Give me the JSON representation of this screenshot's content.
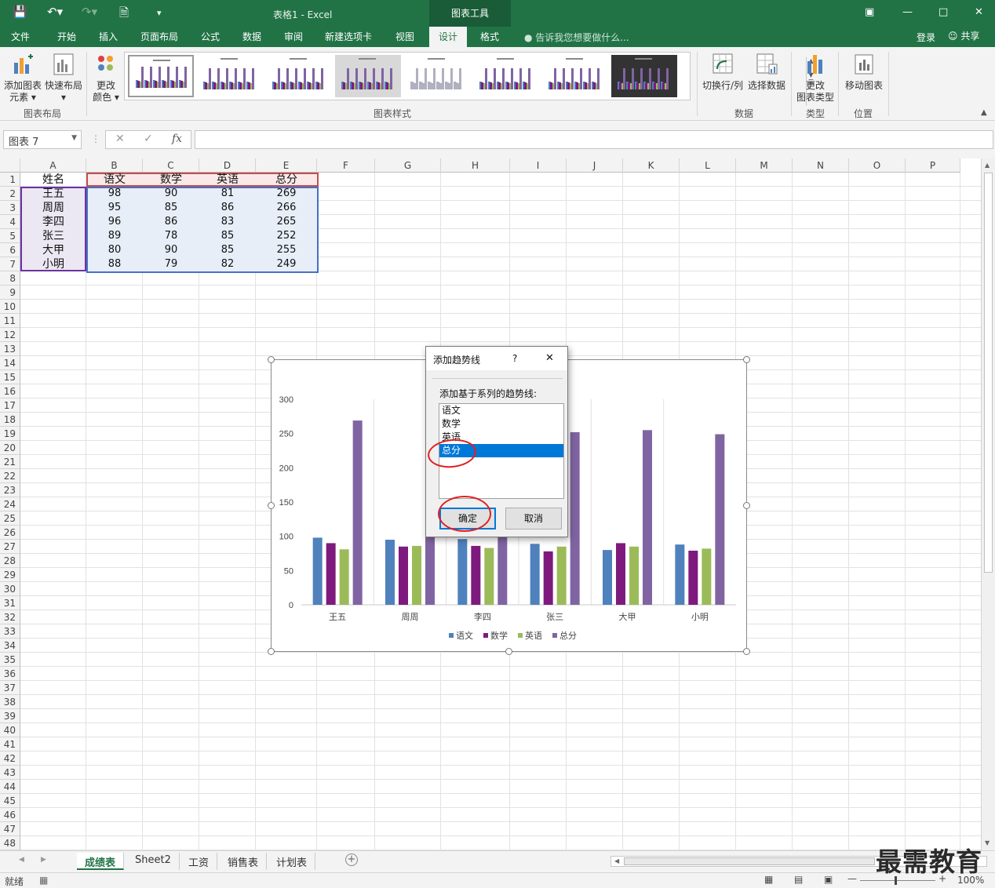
{
  "window": {
    "title": "表格1 - Excel",
    "context_tool": "图表工具",
    "login": "登录",
    "share": "共享"
  },
  "ribbon_tabs": [
    "文件",
    "开始",
    "插入",
    "页面布局",
    "公式",
    "数据",
    "审阅",
    "新建选项卡",
    "视图",
    "设计",
    "格式"
  ],
  "active_tab": "设计",
  "tell_me": "告诉我您想要做什么...",
  "ribbon": {
    "add_element": "添加图表元素",
    "add_element_l1": "添加图表",
    "add_element_l2": "元素",
    "quick_layout": "快速布局",
    "change_color_l1": "更改",
    "change_color_l2": "颜色",
    "group_layout": "图表布局",
    "group_styles": "图表样式",
    "switch_rowcol": "切换行/列",
    "select_data": "选择数据",
    "group_data": "数据",
    "change_type_l1": "更改",
    "change_type_l2": "图表类型",
    "group_type": "类型",
    "move_chart": "移动图表",
    "group_location": "位置"
  },
  "formula_bar": {
    "name_box": "图表 7",
    "fx": "fx",
    "value": ""
  },
  "columns": [
    "A",
    "B",
    "C",
    "D",
    "E",
    "F",
    "G",
    "H",
    "I",
    "J",
    "K",
    "L",
    "M",
    "N",
    "O",
    "P"
  ],
  "table": {
    "headers": [
      "姓名",
      "语文",
      "数学",
      "英语",
      "总分"
    ],
    "rows": [
      [
        "王五",
        "98",
        "90",
        "81",
        "269"
      ],
      [
        "周周",
        "95",
        "85",
        "86",
        "266"
      ],
      [
        "李四",
        "96",
        "86",
        "83",
        "265"
      ],
      [
        "张三",
        "89",
        "78",
        "85",
        "252"
      ],
      [
        "大甲",
        "80",
        "90",
        "85",
        "255"
      ],
      [
        "小明",
        "88",
        "79",
        "82",
        "249"
      ]
    ]
  },
  "chart_data": {
    "type": "bar",
    "categories": [
      "王五",
      "周周",
      "李四",
      "张三",
      "大甲",
      "小明"
    ],
    "series": [
      {
        "name": "语文",
        "values": [
          98,
          95,
          96,
          89,
          80,
          88
        ]
      },
      {
        "name": "数学",
        "values": [
          90,
          85,
          86,
          78,
          90,
          79
        ]
      },
      {
        "name": "英语",
        "values": [
          81,
          86,
          83,
          85,
          85,
          82
        ]
      },
      {
        "name": "总分",
        "values": [
          269,
          266,
          265,
          252,
          255,
          249
        ]
      }
    ],
    "ylim": [
      0,
      300
    ],
    "yticks": [
      0,
      50,
      100,
      150,
      200,
      250,
      300
    ],
    "legend": "bottom",
    "colors": [
      "#4f81bd",
      "#7e1a7e",
      "#9bbb59",
      "#8064a2"
    ]
  },
  "dialog": {
    "title": "添加趋势线",
    "help": "?",
    "close": "✕",
    "prompt": "添加基于系列的趋势线:",
    "items": [
      "语文",
      "数学",
      "英语",
      "总分"
    ],
    "selected": "总分",
    "ok": "确定",
    "cancel": "取消"
  },
  "sheets": [
    "成绩表",
    "Sheet2",
    "工资",
    "销售表",
    "计划表"
  ],
  "active_sheet": "成绩表",
  "status": {
    "ready": "就绪",
    "zoom": "100%"
  },
  "watermark": "最需教育"
}
